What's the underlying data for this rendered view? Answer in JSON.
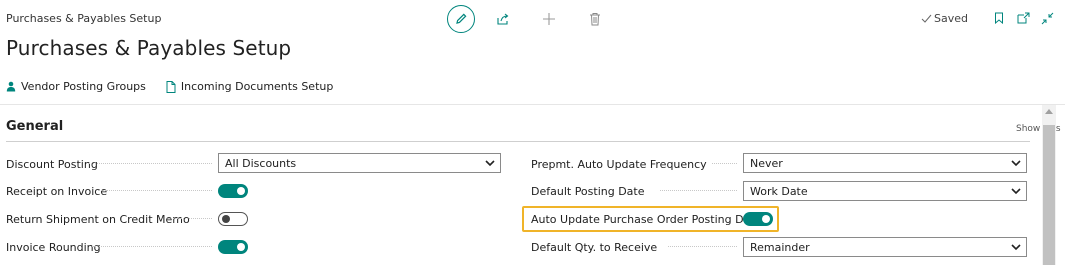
{
  "header": {
    "breadcrumb": "Purchases & Payables Setup",
    "title": "Purchases & Payables Setup",
    "saved_label": "Saved"
  },
  "toolbar_icons": [
    "edit-icon",
    "share-icon",
    "new-icon",
    "delete-icon"
  ],
  "right_icons": [
    "bookmark-icon",
    "open-new-window-icon",
    "collapse-icon"
  ],
  "actions": [
    {
      "label": "Vendor Posting Groups",
      "icon": "person-icon"
    },
    {
      "label": "Incoming Documents Setup",
      "icon": "document-icon"
    }
  ],
  "section": {
    "title": "General",
    "toggle_label": "Show less"
  },
  "left_fields": {
    "discount_posting": {
      "label": "Discount Posting",
      "value": "All Discounts"
    },
    "receipt_on_invoice": {
      "label": "Receipt on Invoice",
      "value": true
    },
    "return_shipment": {
      "label": "Return Shipment on Credit Memo",
      "value": false
    },
    "invoice_rounding": {
      "label": "Invoice Rounding",
      "value": true
    }
  },
  "right_fields": {
    "prepmt_frequency": {
      "label": "Prepmt. Auto Update Frequency",
      "value": "Never"
    },
    "default_posting_date": {
      "label": "Default Posting Date",
      "value": "Work Date"
    },
    "auto_update_po_date": {
      "label": "Auto Update Purchase Order Posting Date",
      "value": true
    },
    "default_qty_receive": {
      "label": "Default Qty. to Receive",
      "value": "Remainder"
    }
  },
  "colors": {
    "accent": "#00857d",
    "highlight": "#f0b429"
  }
}
